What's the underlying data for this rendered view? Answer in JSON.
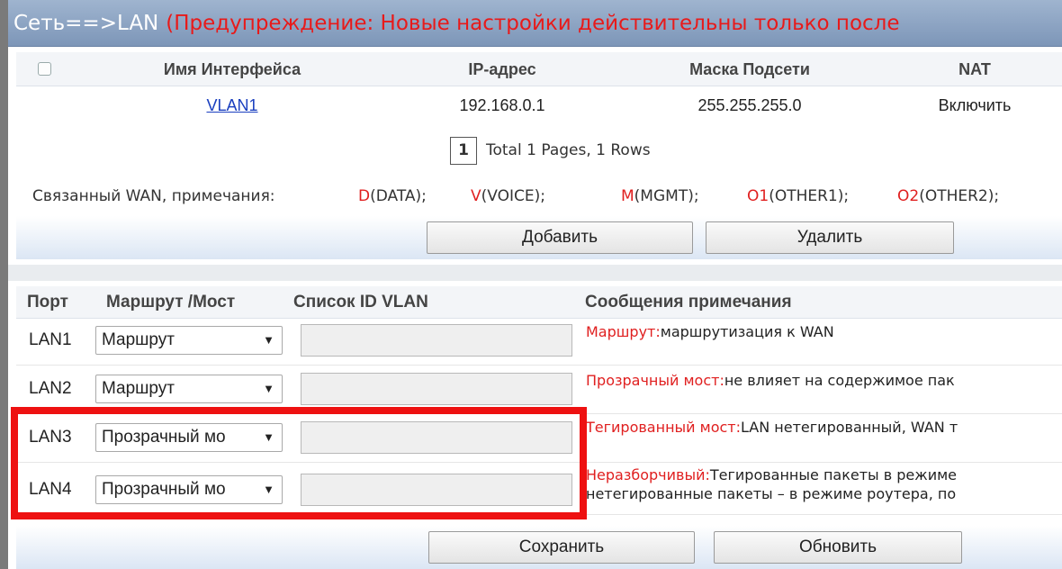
{
  "title": {
    "path": "Сеть==>LAN",
    "warning": "(Предупреждение: Новые настройки действительны только после"
  },
  "interfaces_table": {
    "columns": [
      "Имя Интерфейса",
      "IP-адрес",
      "Маска Подсети",
      "NAT"
    ],
    "rows": [
      {
        "name": "VLAN1",
        "ip": "192.168.0.1",
        "mask": "255.255.255.0",
        "nat": "Включить"
      }
    ]
  },
  "pager": {
    "current_page": "1",
    "info": "Total 1 Pages, 1 Rows"
  },
  "wan_legend": {
    "label": "Связанный WAN, примечания:",
    "items": [
      {
        "key": "D",
        "desc": "(DATA);"
      },
      {
        "key": "V",
        "desc": "(VOICE);"
      },
      {
        "key": "M",
        "desc": "(MGMT);"
      },
      {
        "key": "O1",
        "desc": "(OTHER1);"
      },
      {
        "key": "O2",
        "desc": "(OTHER2);"
      }
    ]
  },
  "buttons_top": {
    "add": "Добавить",
    "delete": "Удалить"
  },
  "lan_table": {
    "columns": {
      "port": "Порт",
      "mode": "Маршрут /Мост",
      "vlan_list": "Список ID VLAN",
      "notes": "Сообщения примечания"
    },
    "rows": [
      {
        "port": "LAN1",
        "mode": "Маршрут",
        "vlan_ids": ""
      },
      {
        "port": "LAN2",
        "mode": "Маршрут",
        "vlan_ids": ""
      },
      {
        "port": "LAN3",
        "mode": "Прозрачный мо",
        "vlan_ids": ""
      },
      {
        "port": "LAN4",
        "mode": "Прозрачный мо",
        "vlan_ids": ""
      }
    ],
    "notes": [
      {
        "key": "Маршрут:",
        "text": "маршрутизация к WAN"
      },
      {
        "key": "Прозрачный мост:",
        "text": "не влияет на содержимое пак"
      },
      {
        "key": "Тегированный мост:",
        "text": "LAN нетегированный, WAN т"
      },
      {
        "key": "Неразборчивый:",
        "text": "Тегированные пакеты в режиме",
        "text2": "нетегированные пакеты – в режиме роутера, по"
      }
    ]
  },
  "buttons_bottom": {
    "save": "Сохранить",
    "refresh": "Обновить"
  },
  "colors": {
    "accent_red": "#e02020",
    "highlight_red": "#ee1111",
    "link_blue": "#1a3fbf",
    "title_bar": "#8aa2c2"
  },
  "icons": {
    "select_arrow": "triangle-down-icon"
  }
}
